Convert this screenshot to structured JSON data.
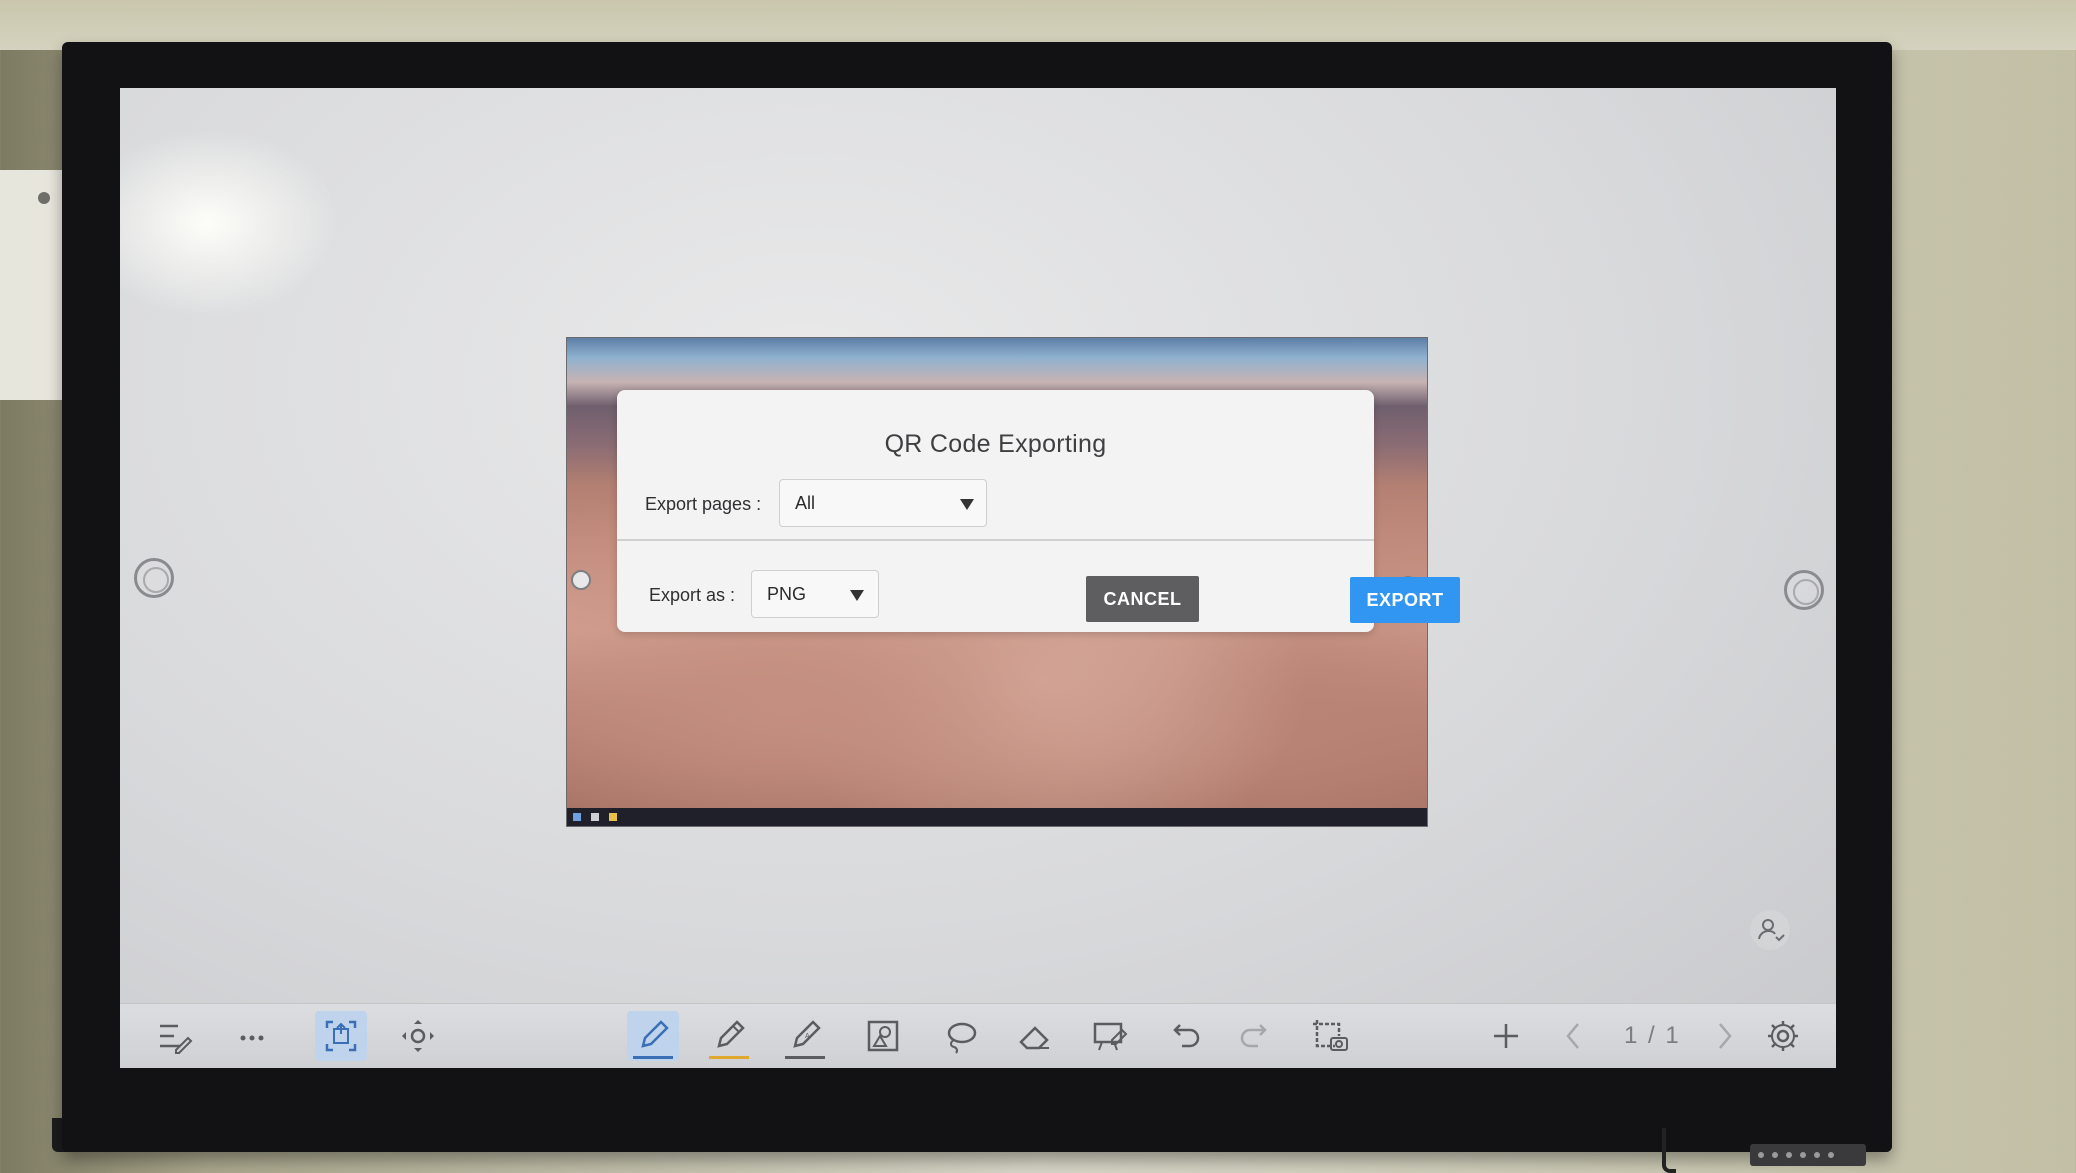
{
  "dialog": {
    "title": "QR Code Exporting",
    "export_pages_label": "Export pages :",
    "export_pages_value": "All",
    "export_as_label": "Export as :",
    "export_as_value": "PNG",
    "cancel_label": "CANCEL",
    "export_label": "EXPORT"
  },
  "toolbar": {
    "page_indicator": "1 / 1",
    "items": [
      "menu-icon",
      "more-icon",
      "scan-icon",
      "move-icon",
      "pen-icon",
      "highlighter-icon",
      "smart-pen-icon",
      "shape-recognition-icon",
      "lasso-icon",
      "eraser-icon",
      "board-edit-icon",
      "undo-icon",
      "redo-icon",
      "screenshot-icon",
      "add-page-icon",
      "prev-page-icon",
      "next-page-icon",
      "settings-icon"
    ]
  },
  "colors": {
    "export_button": "#3196f2",
    "cancel_button": "#5e5e61",
    "active_tool_bg": "#bfd3ec",
    "pen_underline": "#3a6fb5",
    "highlighter_underline": "#e0a82c"
  }
}
